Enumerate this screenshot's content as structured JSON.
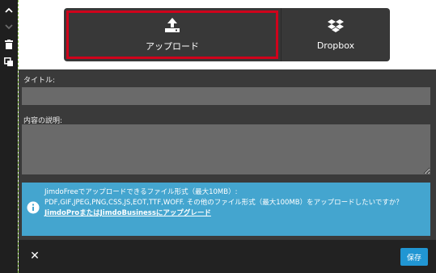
{
  "rail": {
    "up_icon": "chevron-up-icon",
    "down_icon": "chevron-down-icon",
    "trash_icon": "trash-icon",
    "copy_icon": "copy-icon"
  },
  "upload": {
    "upload_label": "アップロード",
    "dropbox_label": "Dropbox"
  },
  "form": {
    "title_label": "タイトル:",
    "title_value": "",
    "description_label": "内容の説明:",
    "description_value": ""
  },
  "info": {
    "line1": "JimdoFreeでアップロードできるファイル形式（最大10MB）:",
    "line2": "PDF,GIF,JPEG,PNG,CSS,JS,EOT,TTF,WOFF. その他のファイル形式（最大100MB）をアップロードしたいですか？",
    "link_text": "JimdoProまたはJimdoBusinessにアップグレード"
  },
  "footer": {
    "close_symbol": "✕",
    "save_label": "保存"
  },
  "colors": {
    "panel": "#3a3a3a",
    "info": "#44a5cf",
    "save": "#2196d3",
    "highlight": "#d0021b"
  }
}
